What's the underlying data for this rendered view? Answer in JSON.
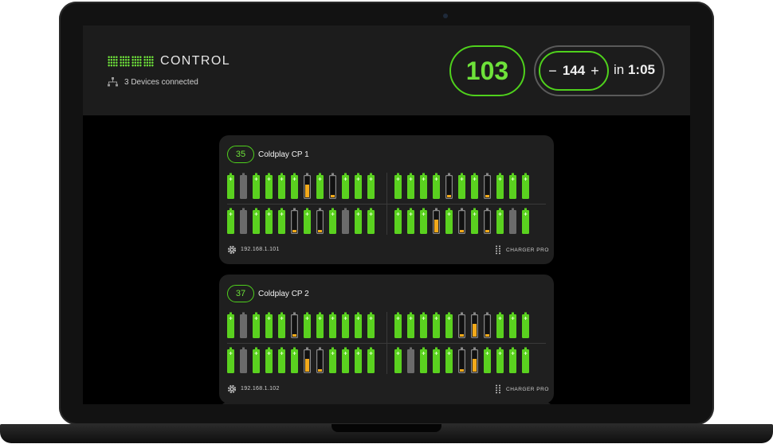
{
  "app": {
    "logo_text": "CONTROL",
    "devices_connected": "3 Devices connected",
    "main_count": "103",
    "stepper": {
      "minus": "−",
      "value": "144",
      "plus": "+"
    },
    "schedule_prefix": "in",
    "schedule_time": "1:05"
  },
  "colors": {
    "accent": "#6ee23a",
    "full": "#5ad11f",
    "low": "#f2a91a",
    "empty": "#6b6b6b"
  },
  "cards": [
    {
      "count": "35",
      "name": "Coldplay CP 1",
      "ip": "192.168.1.101",
      "model": "CHARGER PRO",
      "rows": [
        [
          "f",
          "e",
          "f",
          "f",
          "f",
          "f",
          "h",
          "f",
          "l",
          "f",
          "f",
          "f",
          "f",
          "f",
          "f",
          "f",
          "l",
          "f",
          "f",
          "l",
          "f",
          "f",
          "f"
        ],
        [
          "f",
          "e",
          "f",
          "f",
          "f",
          "l",
          "f",
          "l",
          "f",
          "e",
          "f",
          "f",
          "f",
          "f",
          "f",
          "h",
          "f",
          "l",
          "f",
          "l",
          "f",
          "e",
          "f"
        ]
      ]
    },
    {
      "count": "37",
      "name": "Coldplay CP 2",
      "ip": "192.168.1.102",
      "model": "CHARGER PRO",
      "rows": [
        [
          "f",
          "e",
          "f",
          "f",
          "f",
          "l",
          "f",
          "f",
          "f",
          "f",
          "f",
          "f",
          "f",
          "f",
          "f",
          "f",
          "f",
          "l",
          "h",
          "l",
          "f",
          "f",
          "f"
        ],
        [
          "f",
          "e",
          "f",
          "f",
          "f",
          "f",
          "h",
          "l",
          "f",
          "f",
          "f",
          "f",
          "f",
          "e",
          "f",
          "f",
          "f",
          "l",
          "h",
          "f",
          "f",
          "f",
          "f"
        ]
      ]
    }
  ]
}
